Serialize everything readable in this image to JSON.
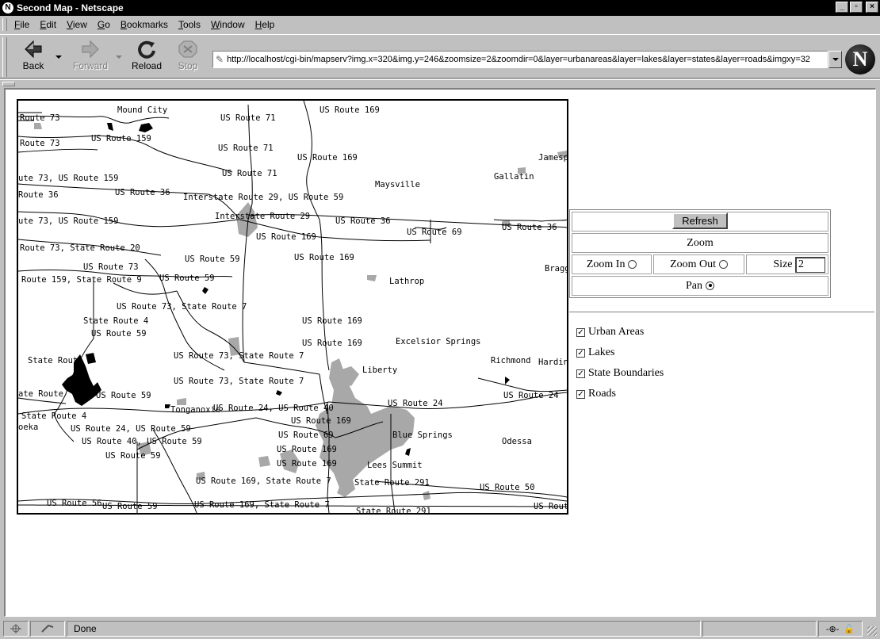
{
  "window": {
    "title": "Second Map - Netscape",
    "buttons": [
      "_",
      "▫",
      "×"
    ]
  },
  "menu": {
    "items": [
      {
        "label": "File",
        "key": "F"
      },
      {
        "label": "Edit",
        "key": "E"
      },
      {
        "label": "View",
        "key": "V"
      },
      {
        "label": "Go",
        "key": "G"
      },
      {
        "label": "Bookmarks",
        "key": "B"
      },
      {
        "label": "Tools",
        "key": "T"
      },
      {
        "label": "Window",
        "key": "W"
      },
      {
        "label": "Help",
        "key": "H"
      }
    ]
  },
  "toolbar": {
    "back_label": "Back",
    "forward_label": "Forward",
    "reload_label": "Reload",
    "stop_label": "Stop",
    "address": "http://localhost/cgi-bin/mapserv?img.x=320&img.y=246&zoomsize=2&zoomdir=0&layer=urbanareas&layer=lakes&layer=states&layer=roads&imgxy=32"
  },
  "map": {
    "labels": [
      "Mound City",
      "US Route 169",
      "Route 73",
      "US Route 71",
      "Route 73",
      "US Route 159",
      "US Route 71",
      "US Route 169",
      "Jamesp",
      "ute 73, US Route 159",
      "US Route 71",
      "Gallatin",
      "Maysville",
      "Route 36",
      "US Route 36",
      "Interstate Route 29, US Route 59",
      "ute 73, US Route 159",
      "Interstate Route 29",
      "US Route 36",
      "US Route 69",
      "US Route 36",
      "US Route 169",
      "Route 73, State Route 20",
      "US Route 59",
      "US Route 169",
      "US Route 73",
      "Bragg",
      "Route 159, State Route 9",
      "US Route 59",
      "Lathrop",
      "US Route 73, State Route 7",
      "State Route 4",
      "US Route 169",
      "US Route 59",
      "US Route 169",
      "Excelsior Springs",
      "US Route 73, State Route 7",
      "State Route 4",
      "Richmond",
      "Hardin",
      "Liberty",
      "US Route 73, State Route 7",
      "ate Route",
      "US Route 59",
      "US Route 24",
      "Tonganoxie",
      "US Route 24, US Route 40",
      "US Route 24",
      "State Route 4",
      "US Route 169",
      "oeka",
      "US Route 24, US Route 59",
      "US Route 69",
      "Blue Springs",
      "US Route 40, US Route 59",
      "US Route 169",
      "Odessa",
      "US Route 59",
      "US Route 169",
      "Lees Summit",
      "US Route 169, State Route 7",
      "State Route 291",
      "US Route 50",
      "US Route 56",
      "US Route 59",
      "US Route 169, State Route 7",
      "State Route 291",
      "US Rout"
    ]
  },
  "controls": {
    "refresh_label": "Refresh",
    "zoom_label": "Zoom",
    "zoom_in_label": "Zoom In",
    "zoom_out_label": "Zoom Out",
    "size_label": "Size",
    "size_value": "2",
    "pan_label": "Pan",
    "selected_mode": "pan"
  },
  "layers": [
    {
      "label": "Urban Areas",
      "checked": true
    },
    {
      "label": "Lakes",
      "checked": true
    },
    {
      "label": "State Boundaries",
      "checked": true
    },
    {
      "label": "Roads",
      "checked": true
    }
  ],
  "status": {
    "text": "Done"
  }
}
